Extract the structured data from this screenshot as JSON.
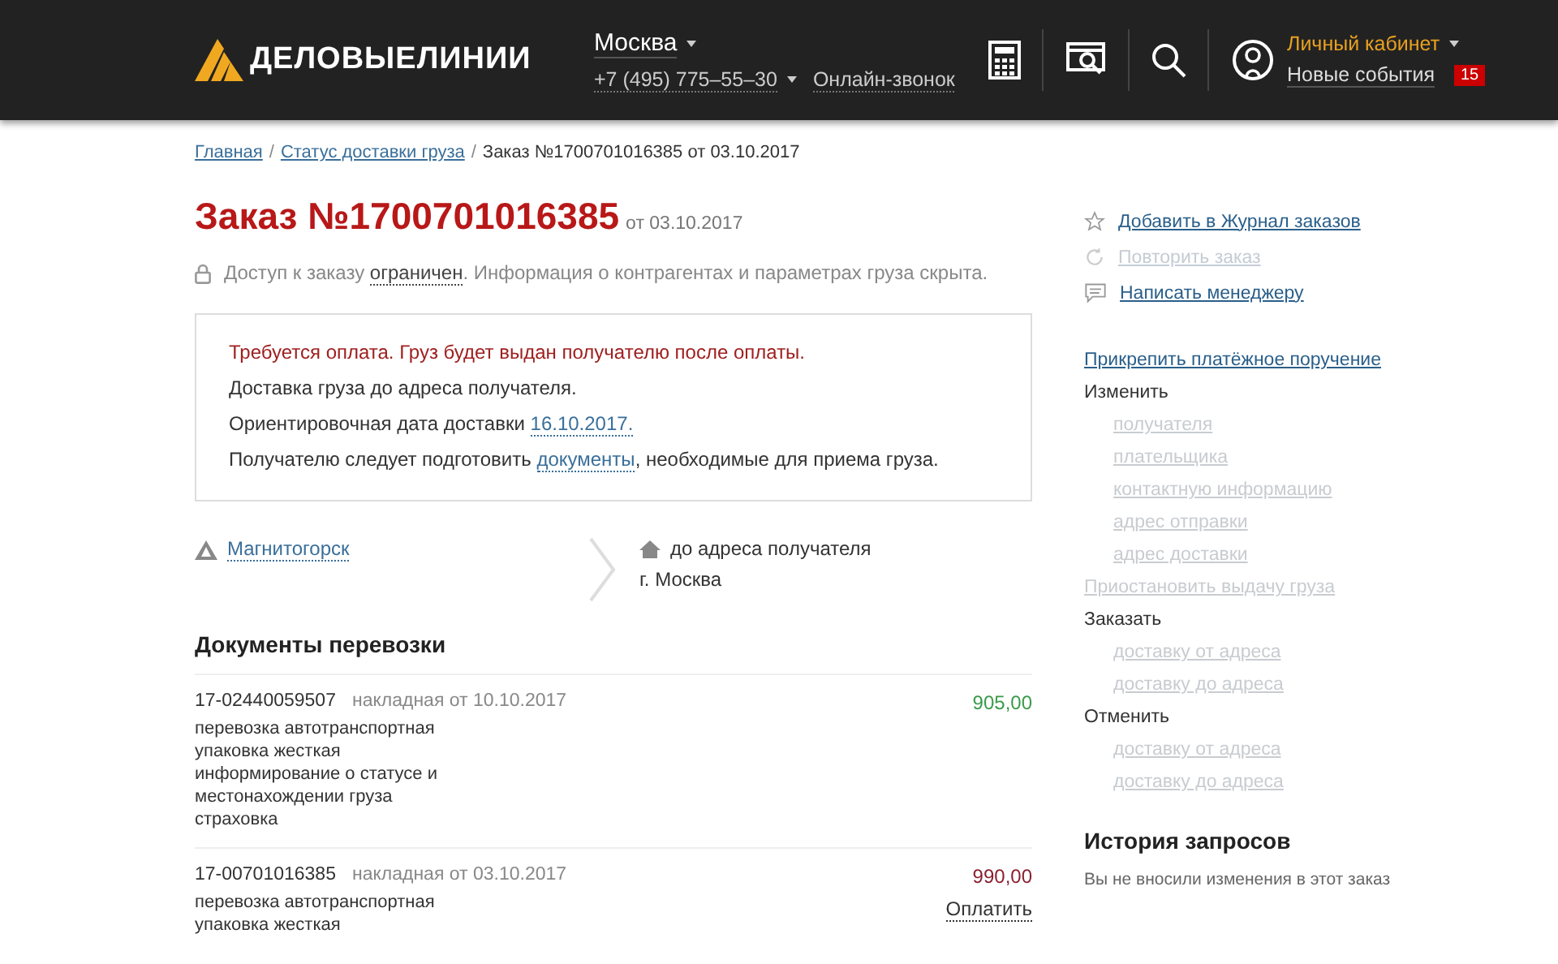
{
  "header": {
    "logo": "ДЕЛОВЫЕЛИНИИ",
    "city": "Москва",
    "phone": "+7 (495) 775–55–30",
    "callback": "Онлайн-звонок",
    "account": "Личный кабинет",
    "events": "Новые события",
    "events_count": "15"
  },
  "breadcrumbs": [
    {
      "label": "Главная",
      "kind": "link"
    },
    {
      "kind": "separator",
      "label": "/"
    },
    {
      "label": "Статус доставки груза",
      "kind": "link"
    },
    {
      "kind": "separator",
      "label": "/"
    },
    {
      "label": "Заказ №1700701016385 от 03.10.2017",
      "kind": "current"
    }
  ],
  "order": {
    "title": "Заказ №1700701016385",
    "date": "от 03.10.2017",
    "access_before": "Доступ к заказу",
    "access_link": "ограничен",
    "access_after": ". Информация о контрагентах и параметрах груза скрыта."
  },
  "notice": {
    "warning": "Требуется оплата. Груз будет выдан получателю после оплаты.",
    "delivery": "Доставка груза до адреса получателя.",
    "date_label": "Ориентировочная дата доставки",
    "date": "16.10.2017.",
    "docs_before": "Получателю следует подготовить",
    "docs_link": "документы",
    "docs_after": ", необходимые для приема груза."
  },
  "route": {
    "from": "Магнитогорск",
    "to": "до адреса получателя",
    "to_city": "г. Москва"
  },
  "documents": {
    "title": "Документы перевозки",
    "rows": [
      {
        "number": "17-02440059507",
        "type": "накладная от 10.10.2017",
        "amount": "905,00",
        "paid": true,
        "services": [
          "перевозка автотранспортная",
          "упаковка жесткая",
          "информирование о статусе и местонахождении груза",
          "страховка"
        ]
      },
      {
        "number": "17-00701016385",
        "type": "накладная от 03.10.2017",
        "amount": "990,00",
        "paid": false,
        "pay": "Оплатить",
        "services": [
          "перевозка автотранспортная",
          "упаковка жесткая"
        ]
      }
    ]
  },
  "sidebar": {
    "actions": [
      {
        "kind": "star",
        "label": "Добавить в Журнал заказов",
        "disabled": false
      },
      {
        "kind": "repeat",
        "label": "Повторить заказ",
        "disabled": true
      },
      {
        "kind": "message",
        "label": "Написать менеджеру",
        "disabled": false
      }
    ],
    "menu": [
      {
        "kind": "link",
        "label": "Прикрепить платёжное поручение",
        "disabled": false
      },
      {
        "kind": "group",
        "label": "Изменить",
        "children": [
          {
            "label": "получателя",
            "disabled": true
          },
          {
            "label": "плательщика",
            "disabled": true
          },
          {
            "label": "контактную информацию",
            "disabled": true
          },
          {
            "label": "адрес отправки",
            "disabled": true
          },
          {
            "label": "адрес доставки",
            "disabled": true
          }
        ]
      },
      {
        "kind": "link",
        "label": "Приостановить выдачу груза",
        "disabled": true
      },
      {
        "kind": "group",
        "label": "Заказать",
        "children": [
          {
            "label": "доставку от адреса",
            "disabled": true
          },
          {
            "label": "доставку до адреса",
            "disabled": true
          }
        ]
      },
      {
        "kind": "group",
        "label": "Отменить",
        "children": [
          {
            "label": "доставку от адреса",
            "disabled": true
          },
          {
            "label": "доставку до адреса",
            "disabled": true
          }
        ]
      }
    ],
    "history": {
      "title": "История запросов",
      "text": "Вы не вносили изменения в этот заказ"
    }
  }
}
